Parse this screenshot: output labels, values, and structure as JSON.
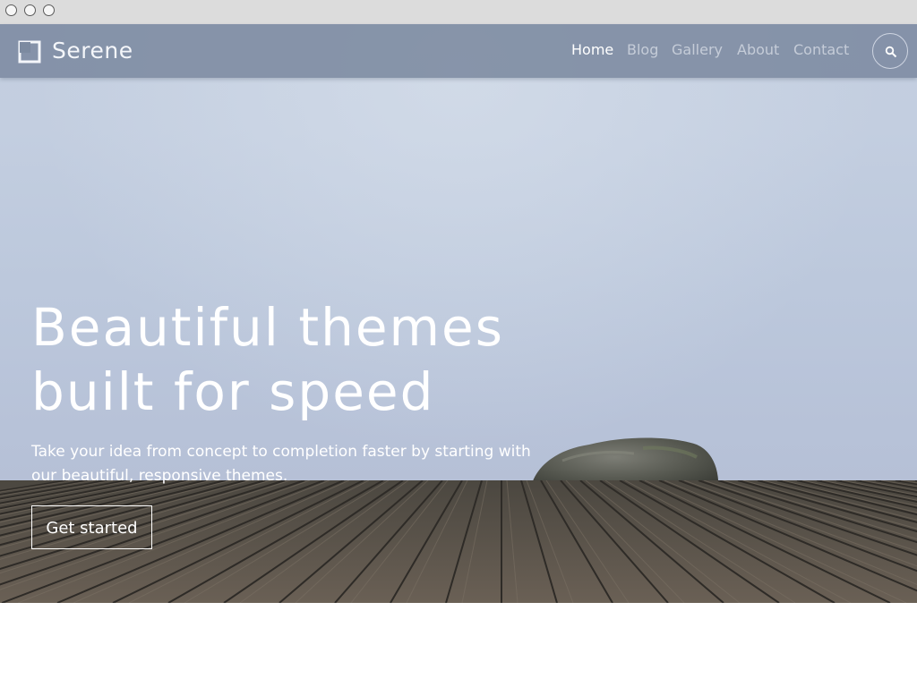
{
  "brand": {
    "name": "Serene"
  },
  "nav": {
    "items": [
      {
        "label": "Home",
        "active": true
      },
      {
        "label": "Blog",
        "active": false
      },
      {
        "label": "Gallery",
        "active": false
      },
      {
        "label": "About",
        "active": false
      },
      {
        "label": "Contact",
        "active": false
      }
    ],
    "search_icon": "search-icon"
  },
  "hero": {
    "headline_line1": "Beautiful themes",
    "headline_line2": "built for speed",
    "subtext_line1": "Take your idea from concept to completion faster by starting with",
    "subtext_line2": "our beautiful, responsive themes.",
    "cta_label": "Get started"
  },
  "colors": {
    "navbar": "#7c8aa0",
    "nav_active": "#ffffff",
    "nav_inactive": "#c5ccd8",
    "sky": "#c4cfe0",
    "deck": "#5a5248"
  }
}
